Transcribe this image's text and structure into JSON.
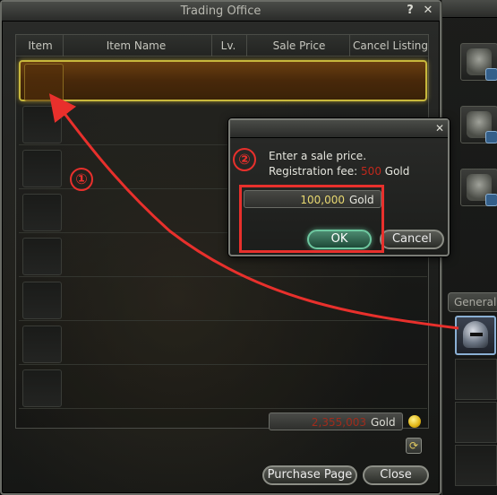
{
  "window": {
    "title": "Trading Office",
    "help_icon": "?",
    "close_icon": "✕"
  },
  "table": {
    "columns": [
      "Item",
      "Item Name",
      "Lv.",
      "Sale Price",
      "Cancel Listing"
    ],
    "row_count": 9,
    "selected_row": 0
  },
  "footer": {
    "gold_amount": "2,355,003",
    "gold_label": "Gold",
    "purchase_button": "Purchase Page",
    "close_button": "Close"
  },
  "dialog": {
    "close_icon": "✕",
    "prompt": "Enter a sale price.",
    "fee_label": "Registration fee:",
    "fee_amount": "500",
    "fee_unit": "Gold",
    "price_value": "100,000",
    "price_unit": "Gold",
    "ok_button": "OK",
    "cancel_button": "Cancel"
  },
  "inventory": {
    "tab_label": "General",
    "selected_item_icon": "helmet-icon"
  },
  "annotations": {
    "step1": "①",
    "step2": "②",
    "color": "#e8302c"
  },
  "colors": {
    "selected_row_border": "#c8b83c",
    "ok_accent": "#6ec8a0",
    "fee_red": "#c0281c"
  }
}
